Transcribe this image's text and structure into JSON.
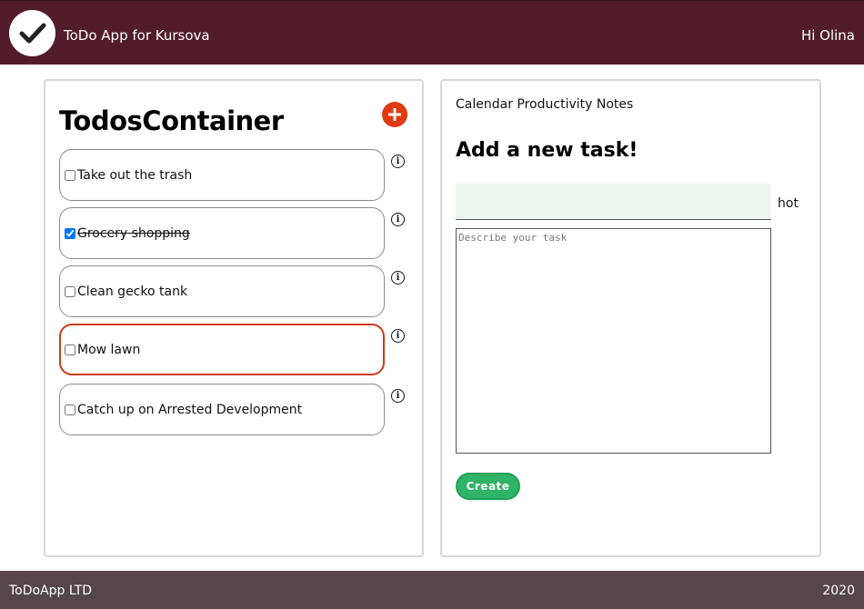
{
  "header": {
    "app_title": "ToDo App for Kursova",
    "greeting": "Hi Olina"
  },
  "todos": {
    "title": "TodosContainer",
    "items": [
      {
        "label": "Take out the trash",
        "checked": false
      },
      {
        "label": "Grocery shopping",
        "checked": true
      },
      {
        "label": "Clean gecko tank",
        "checked": false
      },
      {
        "label": "Mow lawn",
        "checked": false
      },
      {
        "label": "Catch up on Arrested Development",
        "checked": false
      }
    ]
  },
  "tabs": [
    "Calendar",
    "Productivity",
    "Notes"
  ],
  "form": {
    "title": "Add a new task!",
    "title_value": "",
    "hot_label": "hot",
    "description_placeholder": "Describe your task",
    "create_label": "Create"
  },
  "footer": {
    "company": "ToDoApp LTD",
    "year": "2020"
  },
  "colors": {
    "header_bg": "#521c2a",
    "footer_bg": "#55464c",
    "accent_red": "#e03a10",
    "create_green": "#2fb366"
  }
}
